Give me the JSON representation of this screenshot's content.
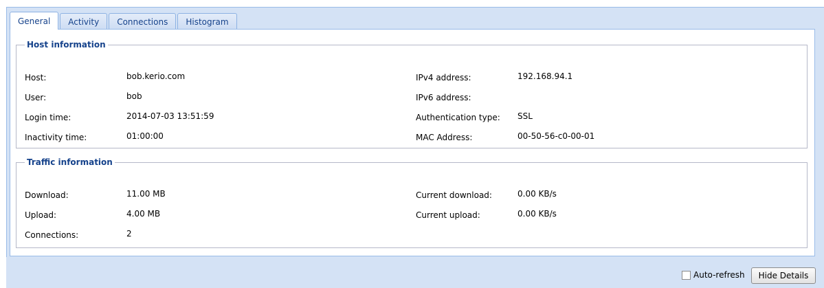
{
  "tabs": [
    {
      "label": "General",
      "active": true
    },
    {
      "label": "Activity",
      "active": false
    },
    {
      "label": "Connections",
      "active": false
    },
    {
      "label": "Histogram",
      "active": false
    }
  ],
  "host_info": {
    "title": "Host information",
    "host_label": "Host:",
    "host_value": "bob.kerio.com",
    "user_label": "User:",
    "user_value": "bob",
    "login_label": "Login time:",
    "login_value": "2014-07-03 13:51:59",
    "inactivity_label": "Inactivity time:",
    "inactivity_value": "01:00:00",
    "ipv4_label": "IPv4 address:",
    "ipv4_value": "192.168.94.1",
    "ipv6_label": "IPv6 address:",
    "ipv6_value": "",
    "auth_label": "Authentication type:",
    "auth_value": "SSL",
    "mac_label": "MAC Address:",
    "mac_value": "00-50-56-c0-00-01"
  },
  "traffic_info": {
    "title": "Traffic information",
    "download_label": "Download:",
    "download_value": "11.00 MB",
    "upload_label": "Upload:",
    "upload_value": "4.00 MB",
    "connections_label": "Connections:",
    "connections_value": "2",
    "cur_download_label": "Current download:",
    "cur_download_value": "0.00 KB/s",
    "cur_upload_label": "Current upload:",
    "cur_upload_value": "0.00 KB/s"
  },
  "footer": {
    "auto_refresh_label": "Auto-refresh",
    "auto_refresh_checked": false,
    "hide_details_label": "Hide Details"
  },
  "colors": {
    "frame_bg": "#d4e2f5",
    "accent": "#15428b",
    "border": "#99bbe8"
  }
}
